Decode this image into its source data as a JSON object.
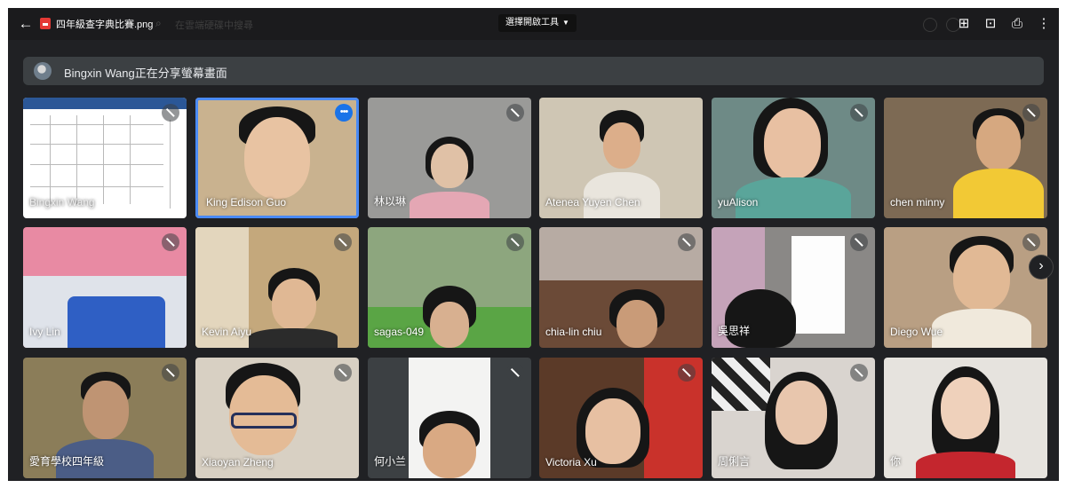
{
  "topbar": {
    "file_name": "四年級查字典比賽.png",
    "search_placeholder": "在雲端硬碟中搜尋",
    "open_with_label": "選擇開啟工具"
  },
  "banner": {
    "share_text": "Bingxin Wang正在分享螢幕畫面"
  },
  "participants": [
    {
      "name": "Bingxin Wang",
      "muted": true
    },
    {
      "name": "King Edison Guo",
      "muted": false,
      "active": true
    },
    {
      "name": "林以琳",
      "muted": true
    },
    {
      "name": "Atenea Yuyen Chen",
      "muted": false
    },
    {
      "name": "yuAlison",
      "muted": true
    },
    {
      "name": "chen minny",
      "muted": true
    },
    {
      "name": "Ivy Lin",
      "muted": true
    },
    {
      "name": "Kevin Aiyu",
      "muted": true
    },
    {
      "name": "sagas-049",
      "muted": true
    },
    {
      "name": "chia-lin chiu",
      "muted": true
    },
    {
      "name": "吳思祥",
      "muted": true
    },
    {
      "name": "Diego Wue",
      "muted": true
    },
    {
      "name": "愛育學校四年級",
      "muted": true
    },
    {
      "name": "Xiaoyan Zheng",
      "muted": true
    },
    {
      "name": "何小兰",
      "muted": true
    },
    {
      "name": "Victoria Xu",
      "muted": true
    },
    {
      "name": "周俐言",
      "muted": true
    },
    {
      "name": "你",
      "muted": false
    }
  ],
  "icons": {
    "back": "arrow-left-icon",
    "file": "image-file-icon",
    "search": "search-icon",
    "add_to_drive": "add-to-drive-icon",
    "open_in_window": "open-in-new-window-icon",
    "print": "printer-icon",
    "more": "more-vert-icon",
    "mic_off": "mic-off-icon",
    "next_page": "chevron-right-icon"
  },
  "colors": {
    "background": "#202124",
    "tile": "#3c4043",
    "active_border": "#4a8af4",
    "accent": "#1a73e8"
  }
}
